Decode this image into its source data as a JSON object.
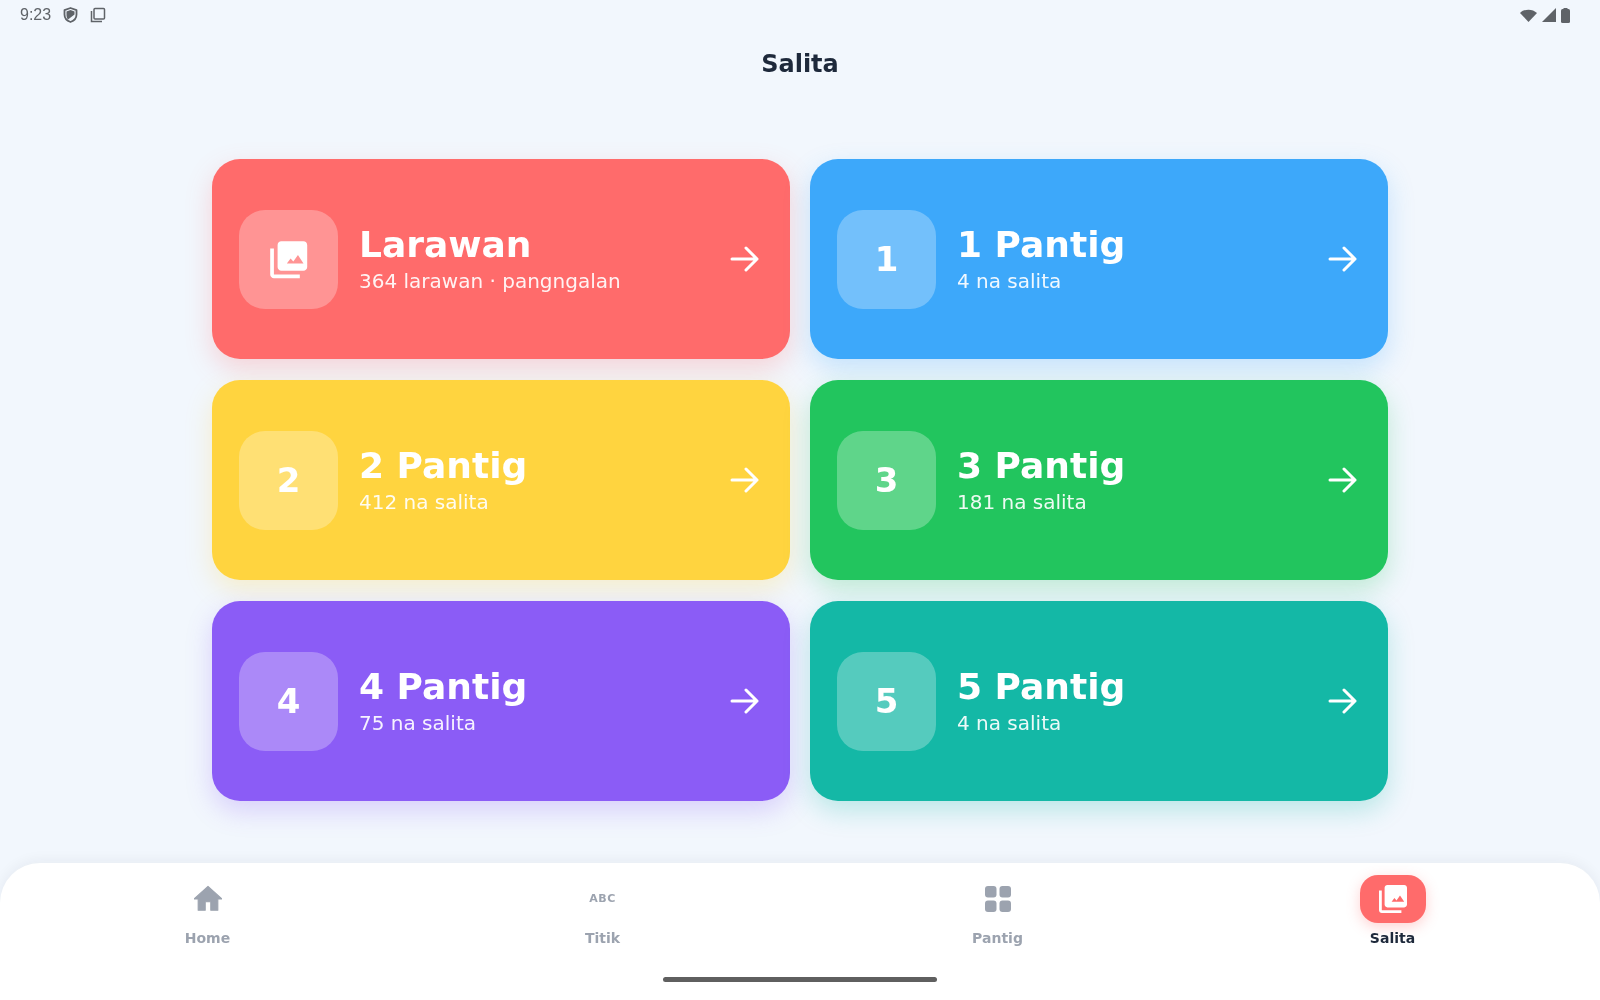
{
  "status_bar": {
    "time": "9:23"
  },
  "header": {
    "title": "Salita"
  },
  "categories": [
    {
      "kind": "image",
      "title": "Larawan",
      "subtitle": "364 larawan · pangngalan",
      "color": "#ff6b6b"
    },
    {
      "kind": "number",
      "number": "1",
      "title": "1 Pantig",
      "subtitle": "4 na salita",
      "color": "#3da8fa"
    },
    {
      "kind": "number",
      "number": "2",
      "title": "2 Pantig",
      "subtitle": "412 na salita",
      "color": "#ffd43f"
    },
    {
      "kind": "number",
      "number": "3",
      "title": "3 Pantig",
      "subtitle": "181 na salita",
      "color": "#22c55e"
    },
    {
      "kind": "number",
      "number": "4",
      "title": "4 Pantig",
      "subtitle": "75 na salita",
      "color": "#8b5cf6"
    },
    {
      "kind": "number",
      "number": "5",
      "title": "5 Pantig",
      "subtitle": "4 na salita",
      "color": "#14b8a6"
    }
  ],
  "nav": {
    "items": [
      {
        "kind": "home",
        "label": "Home",
        "selected": false
      },
      {
        "kind": "text",
        "glyph": "ABC",
        "label": "Titik",
        "selected": false
      },
      {
        "kind": "grid",
        "label": "Pantig",
        "selected": false
      },
      {
        "kind": "image",
        "label": "Salita",
        "selected": true
      }
    ]
  }
}
